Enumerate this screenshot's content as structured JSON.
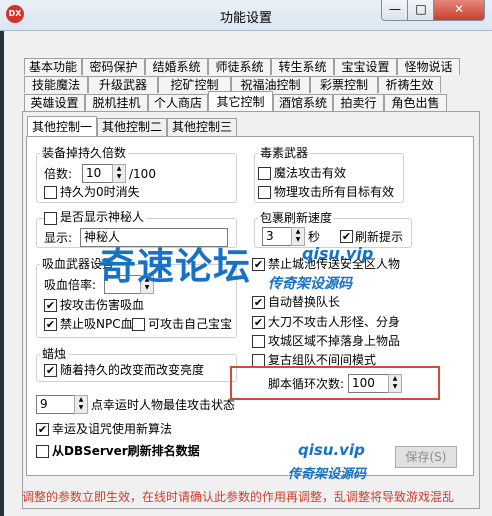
{
  "window": {
    "title": "功能设置",
    "icon_text": "DX",
    "min": "—",
    "max": "□",
    "close": "✕"
  },
  "tabs": {
    "row1": [
      "基本功能",
      "密码保护",
      "结婚系统",
      "师徒系统",
      "转生系统",
      "宝宝设置",
      "怪物说话"
    ],
    "row2": [
      "技能魔法",
      "升级武器",
      "挖矿控制",
      "祝福油控制",
      "彩票控制",
      "祈祷生效"
    ],
    "row3": [
      "英雄设置",
      "脱机挂机",
      "个人商店",
      "其它控制",
      "酒馆系统",
      "拍卖行",
      "角色出售"
    ]
  },
  "subtabs": [
    "其他控制一",
    "其他控制二",
    "其他控制三"
  ],
  "equip": {
    "title": "装备掉持久倍数",
    "multiplier_label": "倍数:",
    "multiplier_value": "10",
    "suffix": "/100",
    "zero_vanish": "持久为0时消失"
  },
  "poison": {
    "title": "毒素武器",
    "magic_attack": "魔法攻击有效",
    "physical_all": "物理攻击所有目标有效"
  },
  "mystery": {
    "show_label": "是否显示神秘人",
    "display_label": "显示:",
    "display_value": "神秘人"
  },
  "package": {
    "title": "包裹刷新速度",
    "value": "3",
    "unit": "秒",
    "refresh_tip": "刷新提示"
  },
  "vampire": {
    "title": "吸血武器设置",
    "rate_label": "吸血倍率:",
    "by_damage": "按攻击伤害吸血",
    "no_npc": "禁止吸NPC血",
    "attack_own_pet": "可攻击自己宝宝"
  },
  "right_opts": {
    "item1": "禁止城池传送安全区人物",
    "auto_swap": "自动替换队长",
    "blade": "大刀不攻击人形怪、分身",
    "siege": "攻城区域不掉落身上物品",
    "retro": "复古组队不间间模式"
  },
  "candle": {
    "title": "蜡烛",
    "duration_change": "随着持久的改变而改变亮度"
  },
  "luck": {
    "value": "9",
    "label": "点幸运时人物最佳攻击状态"
  },
  "curse": {
    "label": "幸运及诅咒使用新算法"
  },
  "dbserver": {
    "label": "从DBServer刷新排名数据"
  },
  "script": {
    "label": "脚本循环次数:",
    "value": "100"
  },
  "save_button": "保存(S)",
  "status": "调整的参数立即生效，在线时请确认此参数的作用再调整，乱调整将导致游戏混乱",
  "watermark": {
    "cn": "奇速论坛",
    "url": "qisu.vip",
    "slogan": "传奇架设源码",
    "url2": "qisu.vip",
    "slogan2": "传奇架设源码"
  },
  "colors": {
    "accent": "#1672c7",
    "warning": "#d23b2c"
  }
}
